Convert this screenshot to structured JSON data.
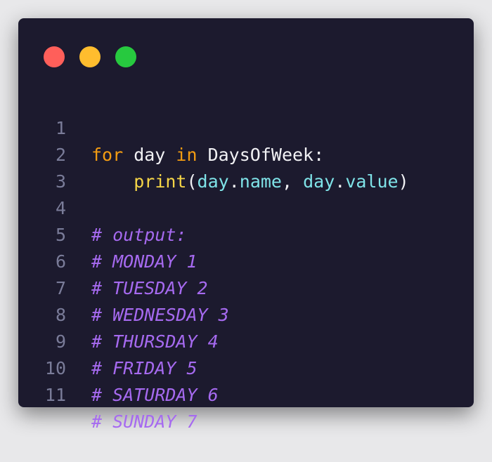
{
  "window": {
    "controls": {
      "close": {
        "icon": "close-dot-icon",
        "color": "#ff5f5a"
      },
      "minimize": {
        "icon": "minimize-dot-icon",
        "color": "#ffbd2e"
      },
      "maximize": {
        "icon": "maximize-dot-icon",
        "color": "#27c93f"
      }
    },
    "background": "#1c1a2e"
  },
  "code": {
    "line_numbers": [
      "1",
      "2",
      "3",
      "4",
      "5",
      "6",
      "7",
      "8",
      "9",
      "10",
      "11"
    ],
    "line1": {
      "kw_for": "for",
      "var": " day ",
      "kw_in": "in",
      "cls": " DaysOfWeek",
      "colon": ":"
    },
    "line2": {
      "indent": "    ",
      "fn": "print",
      "open": "(",
      "obj1": "day",
      "dot1": ".",
      "attr1": "name",
      "comma": ", ",
      "obj2": "day",
      "dot2": ".",
      "attr2": "value",
      "close": ")"
    },
    "comments": [
      "# output:",
      "# MONDAY 1",
      "# TUESDAY 2",
      "# WEDNESDAY 3",
      "# THURSDAY 4",
      "# FRIDAY 5",
      "# SATURDAY 6",
      "# SUNDAY 7"
    ]
  },
  "colors": {
    "keyword": "#f39c12",
    "function": "#f5d547",
    "attribute": "#7fe3e8",
    "comment": "#a66af0",
    "line_number": "#7a7c99",
    "text": "#f1f1f4"
  }
}
